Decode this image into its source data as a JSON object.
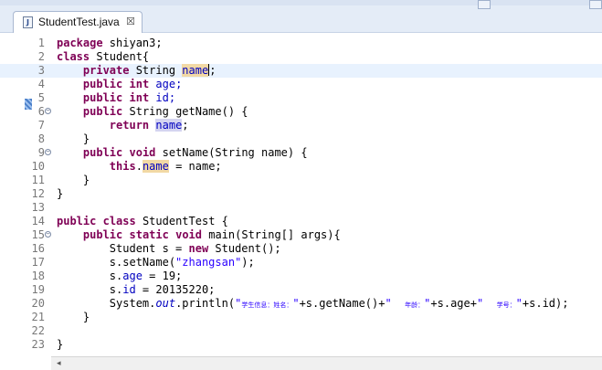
{
  "tab": {
    "title": "StudentTest.java",
    "close_glyph": "☒",
    "icon_letter": "J"
  },
  "colors": {
    "keyword": "#7f0055",
    "string": "#2a00ff",
    "field": "#0000c0",
    "current_line": "#e8f2fe",
    "occurrence": "#f2d9a5"
  },
  "editor": {
    "current_line": 3,
    "lines": [
      {
        "n": "1",
        "fold": ""
      },
      {
        "n": "2",
        "fold": ""
      },
      {
        "n": "3",
        "fold": ""
      },
      {
        "n": "4",
        "fold": ""
      },
      {
        "n": "5",
        "fold": ""
      },
      {
        "n": "6",
        "fold": "−"
      },
      {
        "n": "7",
        "fold": ""
      },
      {
        "n": "8",
        "fold": ""
      },
      {
        "n": "9",
        "fold": "−"
      },
      {
        "n": "10",
        "fold": ""
      },
      {
        "n": "11",
        "fold": ""
      },
      {
        "n": "12",
        "fold": ""
      },
      {
        "n": "13",
        "fold": ""
      },
      {
        "n": "14",
        "fold": ""
      },
      {
        "n": "15",
        "fold": "−"
      },
      {
        "n": "16",
        "fold": ""
      },
      {
        "n": "17",
        "fold": ""
      },
      {
        "n": "18",
        "fold": ""
      },
      {
        "n": "19",
        "fold": ""
      },
      {
        "n": "20",
        "fold": ""
      },
      {
        "n": "21",
        "fold": ""
      },
      {
        "n": "22",
        "fold": ""
      },
      {
        "n": "23",
        "fold": ""
      }
    ],
    "code": {
      "l1": {
        "kw": "package",
        "rest": " shiyan3;"
      },
      "l2": {
        "kw": "class",
        "rest": " Student{"
      },
      "l3": {
        "indent": "    ",
        "kw": "private",
        "mid": " String ",
        "name": "name",
        "end": ";"
      },
      "l4": {
        "indent": "    ",
        "kw1": "public",
        "kw2": "int",
        "rest": " age;"
      },
      "l5": {
        "indent": "    ",
        "kw1": "public",
        "kw2": "int",
        "rest": " id;"
      },
      "l6": {
        "indent": "    ",
        "kw": "public",
        "rest": " String getName() {"
      },
      "l7": {
        "indent": "        ",
        "kw": "return",
        "name": "name",
        "end": ";"
      },
      "l8": {
        "text": "    }"
      },
      "l9": {
        "indent": "    ",
        "kw1": "public",
        "kw2": "void",
        "rest": " setName(String name) {"
      },
      "l10": {
        "indent": "        ",
        "kw": "this",
        "dot": ".",
        "name": "name",
        "rest": " = name;"
      },
      "l11": {
        "text": "    }"
      },
      "l12": {
        "text": "}"
      },
      "l13": {
        "text": ""
      },
      "l14": {
        "kw1": "public",
        "kw2": "class",
        "rest": " StudentTest {"
      },
      "l15": {
        "indent": "    ",
        "kw1": "public",
        "kw2": "static",
        "kw3": "void",
        "rest": " main(String[] args){"
      },
      "l16": {
        "pre": "        Student s = ",
        "kw": "new",
        "rest": " Student();"
      },
      "l17": {
        "pre": "        s.setName(",
        "str": "\"zhangsan\"",
        "rest": ");"
      },
      "l18": {
        "pre": "        s.",
        "field": "age",
        "rest": " = 19;"
      },
      "l19": {
        "pre": "        s.",
        "field": "id",
        "rest": " = 20135220;"
      },
      "l20": {
        "pre": "        System.",
        "static": "out",
        "call": ".println(",
        "s1q": "\"",
        "s1": "学生信息：姓名：",
        "s1e": "\"",
        "p1": "+s.getName()+",
        "s2q": "\"  ",
        "s2": "年龄：",
        "s2e": "\"",
        "p2": "+s.age+",
        "s3q": "\"  ",
        "s3": "学号：",
        "s3e": "\"",
        "p3": "+s.id);"
      },
      "l21": {
        "text": "    }"
      },
      "l22": {
        "text": ""
      },
      "l23": {
        "text": "}"
      }
    }
  },
  "scrollbar": {
    "left_arrow": "◂"
  }
}
